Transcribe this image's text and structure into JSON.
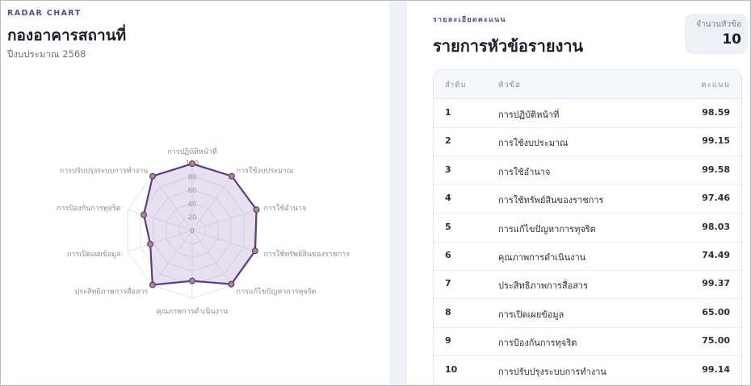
{
  "left": {
    "eyebrow": "RADAR CHART",
    "title": "กองอาคารสถานที่",
    "subtitle": "ปีงบประมาณ 2568"
  },
  "right": {
    "eyebrow": "รายละเอียดคะแนน",
    "title": "รายการหัวข้อรายงาน",
    "count_label": "จำนวนหัวข้อ",
    "count_value": "10",
    "headers": {
      "no": "ลำดับ",
      "topic": "หัวข้อ",
      "score": "คะแนน"
    },
    "rows": [
      {
        "no": "1",
        "topic": "การปฏิบัติหน้าที่",
        "score": "98.59"
      },
      {
        "no": "2",
        "topic": "การใช้งบประมาณ",
        "score": "99.15"
      },
      {
        "no": "3",
        "topic": "การใช้อำนาจ",
        "score": "99.58"
      },
      {
        "no": "4",
        "topic": "การใช้ทรัพย์สินของราชการ",
        "score": "97.46"
      },
      {
        "no": "5",
        "topic": "การแก้ไขปัญหาการทุจริต",
        "score": "98.03"
      },
      {
        "no": "6",
        "topic": "คุณภาพการดำเนินงาน",
        "score": "74.49"
      },
      {
        "no": "7",
        "topic": "ประสิทธิภาพการสื่อสาร",
        "score": "99.37"
      },
      {
        "no": "8",
        "topic": "การเปิดเผยข้อมูล",
        "score": "65.00"
      },
      {
        "no": "9",
        "topic": "การป้องกันการทุจริต",
        "score": "75.00"
      },
      {
        "no": "10",
        "topic": "การปรับปรุงระบบการทำงาน",
        "score": "99.14"
      }
    ]
  },
  "chart_data": {
    "type": "radar",
    "categories": [
      "การปฏิบัติหน้าที่",
      "การใช้งบประมาณ",
      "การใช้อำนาจ",
      "การใช้ทรัพย์สินของราชการ",
      "การแก้ไขปัญหาการทุจริต",
      "คุณภาพการดำเนินงาน",
      "ประสิทธิภาพการสื่อสาร",
      "การเปิดเผยข้อมูล",
      "การป้องกันการทุจริต",
      "การปรับปรุงระบบการทำงาน"
    ],
    "values": [
      98.59,
      99.15,
      99.58,
      97.46,
      98.03,
      74.49,
      99.37,
      65.0,
      75.0,
      99.14
    ],
    "range": [
      0,
      100
    ],
    "tick_labels": [
      "0",
      "20",
      "40",
      "60",
      "80",
      "100"
    ],
    "colors": {
      "line": "#5a3e86",
      "fill": "#b9a6d2",
      "point": "#b48a6f",
      "grid": "#e3e5ea",
      "label": "#8a8c98"
    }
  }
}
